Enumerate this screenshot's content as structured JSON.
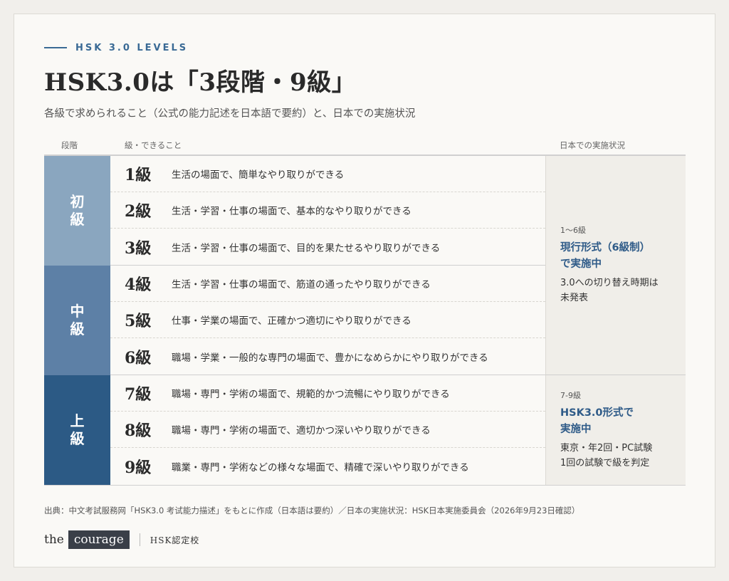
{
  "eyebrow": "HSK 3.0 LEVELS",
  "title": "HSK3.0は「3段階・9級」",
  "subtitle": "各級で求められること（公式の能力記述を日本語で要約）と、日本での実施状況",
  "columns": {
    "stage": "段階",
    "level": "級・できること",
    "status": "日本での実施状況"
  },
  "colors": {
    "stage_beginner": "#8aa6bf",
    "stage_intermediate": "#5d80a6",
    "stage_advanced": "#2c5a85",
    "accent": "#2f5b88"
  },
  "stages": [
    {
      "label": "初級"
    },
    {
      "label": "中級"
    },
    {
      "label": "上級"
    }
  ],
  "levels": [
    {
      "level": "1級",
      "desc": "生活の場面で、簡単なやり取りができる"
    },
    {
      "level": "2級",
      "desc": "生活・学習・仕事の場面で、基本的なやり取りができる"
    },
    {
      "level": "3級",
      "desc": "生活・学習・仕事の場面で、目的を果たせるやり取りができる"
    },
    {
      "level": "4級",
      "desc": "生活・学習・仕事の場面で、筋道の通ったやり取りができる"
    },
    {
      "level": "5級",
      "desc": "仕事・学業の場面で、正確かつ適切にやり取りができる"
    },
    {
      "level": "6級",
      "desc": "職場・学業・一般的な専門の場面で、豊かになめらかにやり取りができる"
    },
    {
      "level": "7級",
      "desc": "職場・専門・学術の場面で、規範的かつ流暢にやり取りができる"
    },
    {
      "level": "8級",
      "desc": "職場・専門・学術の場面で、適切かつ深いやり取りができる"
    },
    {
      "level": "9級",
      "desc": "職業・専門・学術などの様々な場面で、精確で深いやり取りができる"
    }
  ],
  "status": [
    {
      "label": "1〜6級",
      "highlight_1": "現行形式（6級制）",
      "highlight_2": "で実施中",
      "note_1": "3.0への切り替え時期は",
      "note_2": "未発表"
    },
    {
      "label": "7-9級",
      "highlight_1": "HSK3.0形式で",
      "highlight_2": "実施中",
      "note_1": "東京・年2回・PC試験",
      "note_2": "1回の試験で級を判定"
    }
  ],
  "source": "出典：中文考試服務网「HSK3.0 考试能力描述」をもとに作成（日本語は要約）／日本の実施状況：HSK日本実施委員会（2026年9月23日確認）",
  "footer": {
    "the": "the",
    "brand": "courage",
    "school": "HSK認定校"
  }
}
